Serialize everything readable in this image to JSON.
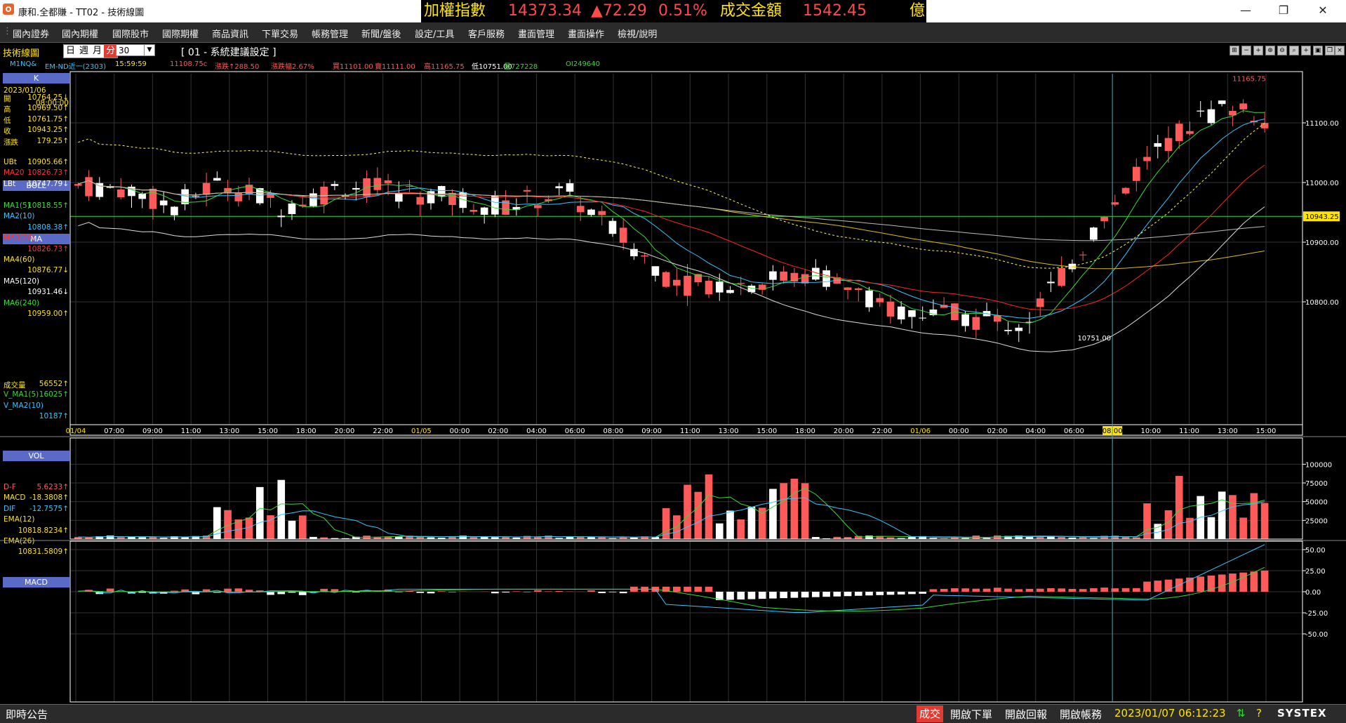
{
  "window": {
    "title": "康和.全都賺 - TT02 - 技術線圖",
    "ticker": {
      "label": "加權指數",
      "price": "14373.34",
      "change": "▲72.29",
      "percent": "0.51%",
      "amount_label": "成交金額",
      "amount": "1542.45",
      "unit": "億"
    },
    "controls": {
      "minimize": "—",
      "restore": "❐",
      "close": "✕"
    }
  },
  "menu": [
    "國內證券",
    "國內期權",
    "國際股市",
    "國際期權",
    "商品資訊",
    "下單交易",
    "帳務管理",
    "新聞/盤後",
    "設定/工具",
    "客戶服務",
    "畫面管理",
    "畫面操作",
    "檢視/說明"
  ],
  "toolbar": {
    "chart_label": "技術線圖",
    "period_tabs": [
      "日",
      "週",
      "月",
      "分"
    ],
    "period_selected": "分",
    "period_value": "30",
    "system_setting": "[ 01 - 系統建議設定 ]",
    "icons": [
      "add-icon",
      "minus-icon",
      "plus-icon",
      "zoom-in-icon",
      "zoom-out-icon",
      "search-icon",
      "crosshair-icon",
      "save-icon",
      "copy-icon",
      "close-icon"
    ]
  },
  "info_line": {
    "symbol": "M1NQ&",
    "name": "EM-ND近一(2303)",
    "time": "15:59:59",
    "price": "11108.75c",
    "change": "漲跌↑288.50",
    "pct": "漲跌幅2.67%",
    "buy": "買11101.00",
    "sell": "賣11111.00",
    "high": "高11165.75",
    "low": "低10751.00",
    "volume": "量727228",
    "oi": "OI249640"
  },
  "left_panel": {
    "k_header": "K",
    "date": "2023/01/06",
    "time": "08:00:00",
    "k_rows": [
      {
        "k": "開",
        "v": "10764.25↓"
      },
      {
        "k": "高",
        "v": "10969.50↑"
      },
      {
        "k": "低",
        "v": "10761.75↑"
      },
      {
        "k": "收",
        "v": "10943.25↑"
      },
      {
        "k": "漲跌",
        "v": "179.25↑"
      }
    ],
    "boll_header": "BOLL",
    "boll_rows": [
      {
        "k": "UBt",
        "v": "10905.66↑"
      },
      {
        "k": "MA20",
        "v": "10826.73↑"
      },
      {
        "k": "LBt",
        "v": "10747.79↓"
      }
    ],
    "ma_header": "MA",
    "ma_rows": [
      {
        "k": "MA1(5)",
        "v": "10818.55↑"
      },
      {
        "k": "MA2(10)",
        "v": ""
      },
      {
        "k": "",
        "v": "10808.38↑"
      },
      {
        "k": "MA3(20)",
        "v": ""
      },
      {
        "k": "",
        "v": "10826.73↑"
      },
      {
        "k": "MA4(60)",
        "v": ""
      },
      {
        "k": "",
        "v": "10876.77↓"
      },
      {
        "k": "MA5(120)",
        "v": ""
      },
      {
        "k": "",
        "v": "10931.46↓"
      },
      {
        "k": "MA6(240)",
        "v": ""
      },
      {
        "k": "",
        "v": "10959.00↑"
      }
    ],
    "vol_header": "VOL",
    "vol_rows": [
      {
        "k": "成交量",
        "v": "56552↑"
      },
      {
        "k": "V_MA1(5)",
        "v": "16025↑"
      },
      {
        "k": "V_MA2(10)",
        "v": ""
      },
      {
        "k": "",
        "v": "10187↑"
      }
    ],
    "macd_header": "MACD",
    "macd_rows": [
      {
        "k": "D-F",
        "v": "5.6233↑"
      },
      {
        "k": "MACD",
        "v": "-18.3808↑"
      },
      {
        "k": "DIF",
        "v": "-12.7575↑"
      },
      {
        "k": "EMA(12)",
        "v": ""
      },
      {
        "k": "",
        "v": "10818.8234↑"
      },
      {
        "k": "EMA(26)",
        "v": ""
      },
      {
        "k": "",
        "v": "10831.5809↑"
      }
    ]
  },
  "price_chart": {
    "y_ticks": [
      "11100.00",
      "11000.00",
      "10900.00",
      "10800.00"
    ],
    "current_price_tag": "10943.25",
    "high_label": "11165.75",
    "low_label": "10751.00",
    "x_labels": [
      {
        "t": "01/04",
        "hl": true
      },
      {
        "t": "07:00"
      },
      {
        "t": "09:00"
      },
      {
        "t": "11:00"
      },
      {
        "t": "13:00"
      },
      {
        "t": "15:00"
      },
      {
        "t": "18:00"
      },
      {
        "t": "20:00"
      },
      {
        "t": "22:00"
      },
      {
        "t": "01/05",
        "hl": true
      },
      {
        "t": "00:00"
      },
      {
        "t": "02:00"
      },
      {
        "t": "04:00"
      },
      {
        "t": "06:00"
      },
      {
        "t": "08:00"
      },
      {
        "t": "09:00"
      },
      {
        "t": "11:00"
      },
      {
        "t": "13:00"
      },
      {
        "t": "15:00"
      },
      {
        "t": "18:00"
      },
      {
        "t": "20:00"
      },
      {
        "t": "22:00"
      },
      {
        "t": "01/06",
        "hl": true
      },
      {
        "t": "00:00"
      },
      {
        "t": "02:00"
      },
      {
        "t": "04:00"
      },
      {
        "t": "06:00"
      },
      {
        "t": "08:00",
        "box": true
      },
      {
        "t": "10:00"
      },
      {
        "t": "11:00"
      },
      {
        "t": "13:00"
      },
      {
        "t": "15:00"
      }
    ]
  },
  "volume_chart": {
    "y_ticks": [
      "100000",
      "75000",
      "50000",
      "25000"
    ]
  },
  "macd_chart": {
    "y_ticks": [
      "50.00",
      "25.00",
      "0.00",
      "-25.00",
      "-50.00"
    ]
  },
  "colors": {
    "up": "#ff5a5a",
    "down": "#ffffff",
    "ma5": "#33dd33",
    "ma10": "#33c8ff",
    "ma20": "#ff2222",
    "ma60": "#e0c000",
    "ma120": "#bbbbbb",
    "ma240": "#22cc44",
    "boll": "#ffff33",
    "grid": "#333333",
    "axis": "#ffffff"
  },
  "status": {
    "news": "即時公告",
    "trade": "成交",
    "open_order": "開啟下單",
    "open_report": "開啟回報",
    "open_account": "開啟帳務",
    "datetime": "2023/01/07 06:12:23",
    "brand": "SYSTEX"
  }
}
